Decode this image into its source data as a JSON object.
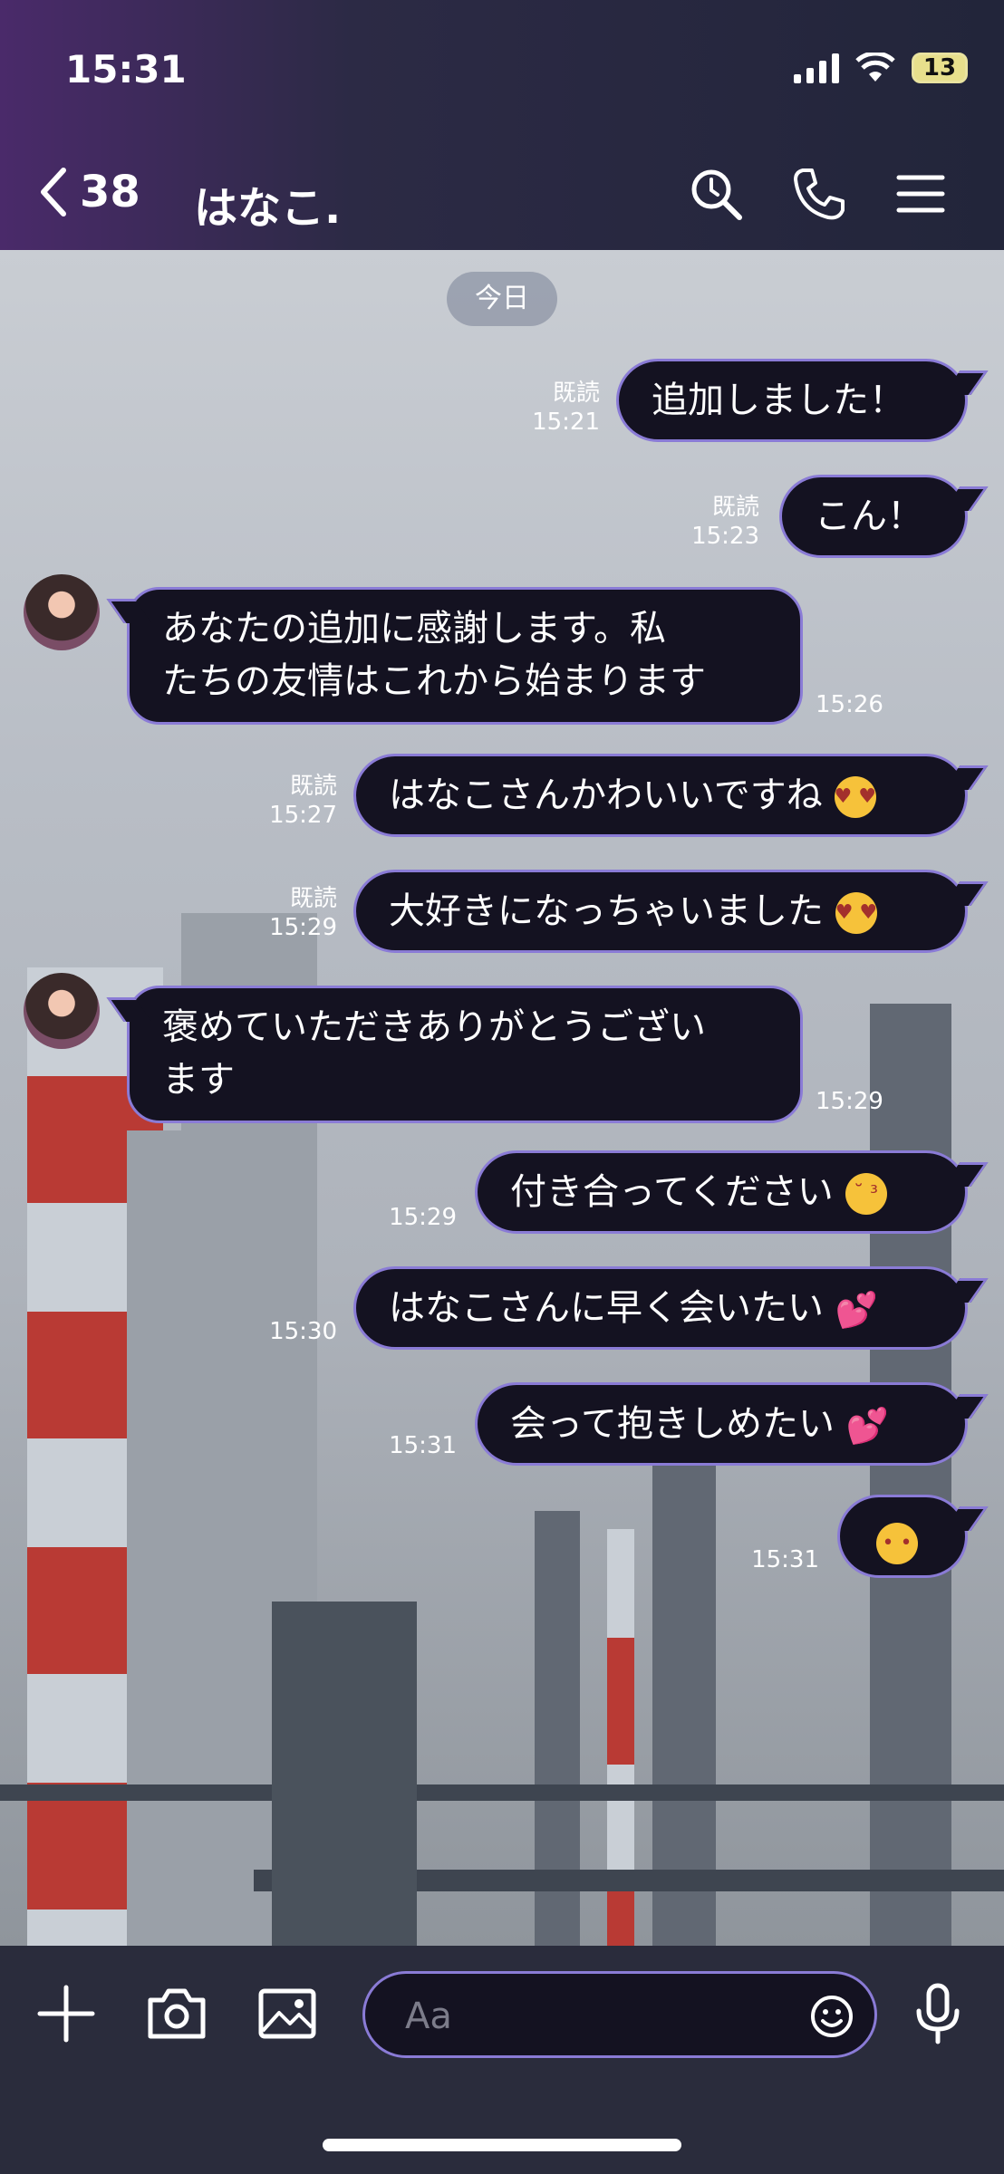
{
  "status": {
    "time": "15:31",
    "battery": "13"
  },
  "header": {
    "back_count": "38",
    "title": "はなこ."
  },
  "date_chip": "今日",
  "messages": [
    {
      "text": "追加しました！",
      "read": "既読",
      "time": "15:21"
    },
    {
      "text": "こん！",
      "read": "既読",
      "time": "15:23"
    },
    {
      "line1": "あなたの追加に感謝します。私",
      "line2": "たちの友情はこれから始まります",
      "time": "15:26"
    },
    {
      "text": "はなこさんかわいいですね",
      "read": "既読",
      "time": "15:27"
    },
    {
      "text": "大好きになっちゃいました",
      "read": "既読",
      "time": "15:29"
    },
    {
      "line1": "褒めていただきありがとうござい",
      "line2": "ます",
      "time": "15:29"
    },
    {
      "text": "付き合ってください",
      "time": "15:29"
    },
    {
      "text": "はなこさんに早く会いたい",
      "time": "15:30"
    },
    {
      "text": "会って抱きしめたい",
      "time": "15:31"
    },
    {
      "text": "",
      "time": "15:31"
    }
  ],
  "composer": {
    "placeholder": "Aa"
  },
  "icons": [
    "chevron-left-icon",
    "search-icon",
    "phone-icon",
    "menu-icon",
    "plus-icon",
    "camera-icon",
    "image-icon",
    "emoji-icon",
    "mic-icon"
  ],
  "colors": {
    "bubble_bg": "#141221",
    "bubble_border": "#8a7bd6",
    "header_bg": "#2c2a45"
  }
}
